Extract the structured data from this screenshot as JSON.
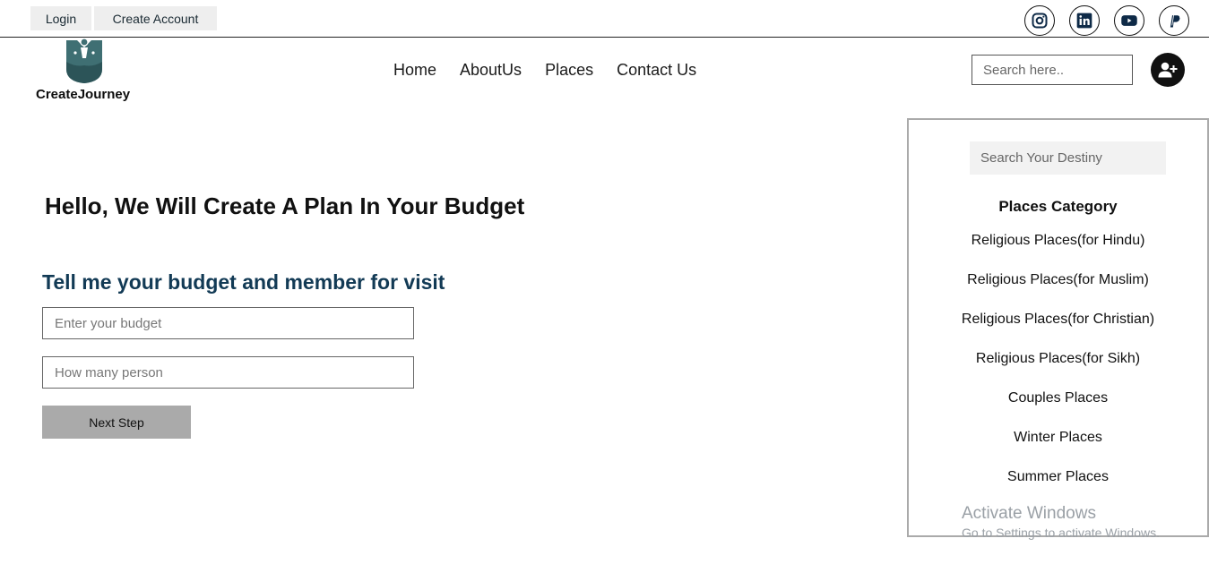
{
  "topbar": {
    "login_label": "Login",
    "create_account_label": "Create Account",
    "social": [
      {
        "name": "instagram-icon"
      },
      {
        "name": "linkedin-icon"
      },
      {
        "name": "youtube-icon"
      },
      {
        "name": "paypal-icon"
      }
    ]
  },
  "brand": {
    "name": "CreateJourney"
  },
  "nav": {
    "items": [
      "Home",
      "AboutUs",
      "Places",
      "Contact Us"
    ]
  },
  "header_search": {
    "placeholder": "Search here.."
  },
  "main": {
    "title": "Hello, We Will Create A Plan In Your Budget",
    "subtitle": "Tell me your budget and member for visit",
    "budget_placeholder": "Enter your budget",
    "person_placeholder": "How many person",
    "next_label": "Next Step"
  },
  "sidebar": {
    "search_placeholder": "Search Your Destiny",
    "category_title": "Places Category",
    "categories": [
      "Religious Places(for Hindu)",
      "Religious Places(for Muslim)",
      "Religious Places(for Christian)",
      "Religious Places(for Sikh)",
      "Couples Places",
      "Winter Places",
      "Summer Places"
    ]
  },
  "watermark": {
    "line1": "Activate Windows",
    "line2": "Go to Settings to activate Windows."
  },
  "colors": {
    "subtitle": "#123a55",
    "logo": "#3f6f73",
    "social_icon": "#0e2a47"
  }
}
